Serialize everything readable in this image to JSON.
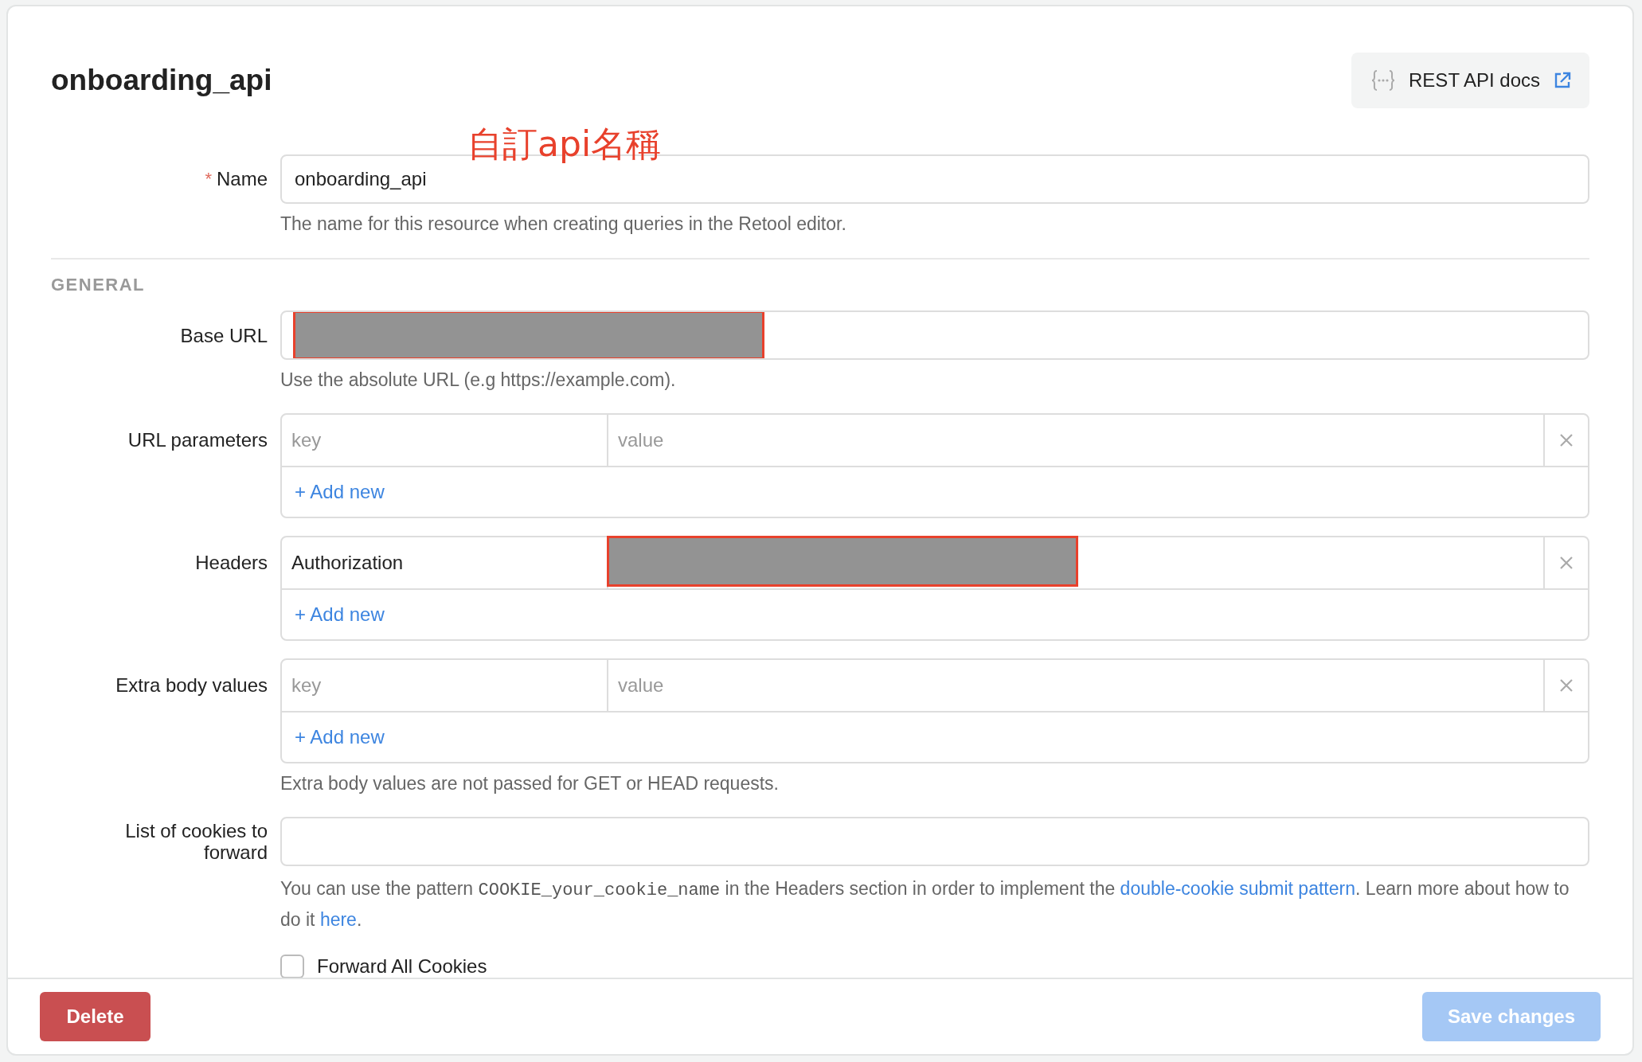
{
  "title": "onboarding_api",
  "docs_button": {
    "label": "REST API docs"
  },
  "annotation": {
    "text": "自訂api名稱"
  },
  "name_field": {
    "required_mark": "*",
    "label": "Name",
    "value": "onboarding_api",
    "help": "The name for this resource when creating queries in the Retool editor."
  },
  "general": {
    "heading": "GENERAL",
    "fields": [
      {
        "kind": "text",
        "label": "Base URL",
        "value_redacted": true,
        "help": "Use the absolute URL (e.g https://example.com)."
      },
      {
        "kind": "pairs",
        "label": "URL parameters",
        "rows": [
          {
            "key": "",
            "key_placeholder": "key",
            "value_placeholder": "value",
            "value_redacted": false
          }
        ],
        "add_label": "+ Add new"
      },
      {
        "kind": "pairs",
        "label": "Headers",
        "rows": [
          {
            "key": "Authorization",
            "value_redacted": true
          }
        ],
        "add_label": "+ Add new"
      },
      {
        "kind": "pairs",
        "label": "Extra body values",
        "rows": [
          {
            "key": "",
            "key_placeholder": "key",
            "value_placeholder": "value",
            "value_redacted": false
          }
        ],
        "add_label": "+ Add new",
        "help": "Extra body values are not passed for GET or HEAD requests."
      },
      {
        "kind": "text",
        "label": "List of cookies to forward",
        "value_redacted": false,
        "help_parts": [
          {
            "kind": "text",
            "text": "You can use the pattern "
          },
          {
            "kind": "code",
            "text": "COOKIE_your_cookie_name"
          },
          {
            "kind": "text",
            "text": "  in the Headers section in order to implement the "
          },
          {
            "kind": "link",
            "text": "double-cookie submit pattern"
          },
          {
            "kind": "text",
            "text": ". Learn more about how to do it "
          },
          {
            "kind": "link",
            "text": "here"
          },
          {
            "kind": "text",
            "text": "."
          }
        ]
      }
    ]
  },
  "forward_all_cookies": {
    "label": "Forward All Cookies",
    "checked": false
  },
  "footer": {
    "delete_label": "Delete",
    "save": {
      "label": "Save changes",
      "disabled": true
    }
  }
}
